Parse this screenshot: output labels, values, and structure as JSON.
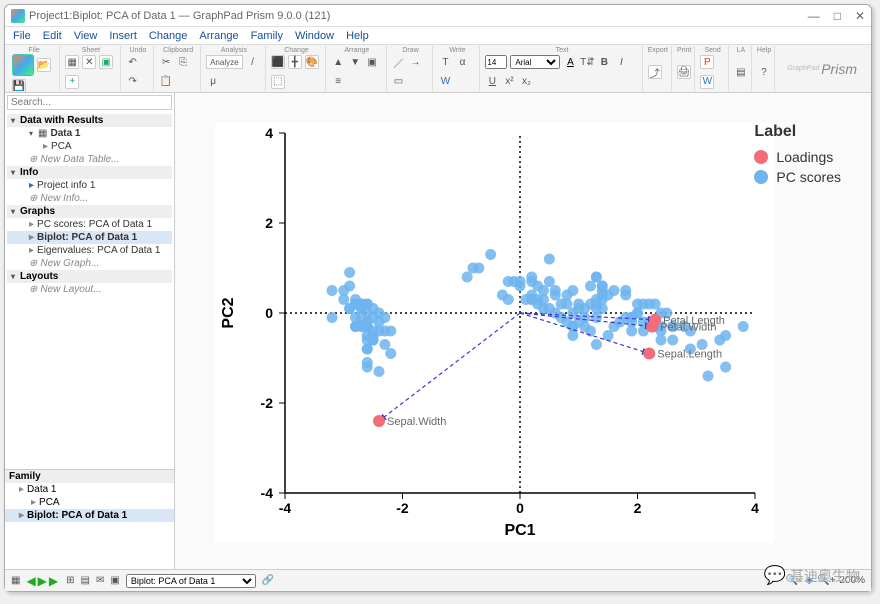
{
  "window": {
    "title": "Project1:Biplot: PCA of Data 1 — GraphPad Prism 9.0.0 (121)",
    "min": "—",
    "max": "□",
    "close": "✕"
  },
  "menu": [
    "File",
    "Edit",
    "View",
    "Insert",
    "Change",
    "Arrange",
    "Family",
    "Window",
    "Help"
  ],
  "ribbon": {
    "groups": [
      "File",
      "Sheet",
      "Undo",
      "Clipboard",
      "Analysis",
      "Change",
      "Arrange",
      "Draw",
      "Write",
      "Text",
      "Export",
      "Print",
      "Send",
      "LA",
      "Help"
    ],
    "font_size": "14",
    "font_name": "Arial",
    "analyze_btn": "Analyze",
    "logo": "Prism",
    "logo_sub": "GraphPad"
  },
  "search": {
    "placeholder": "Search..."
  },
  "tree": {
    "sections": [
      {
        "title": "Data with Results",
        "items": [
          {
            "label": "Data 1",
            "bold": true
          },
          {
            "label": "PCA",
            "sub": true
          },
          {
            "label": "New Data Table...",
            "new": true
          }
        ]
      },
      {
        "title": "Info",
        "items": [
          {
            "label": "Project info 1",
            "color": "#2a6db5"
          },
          {
            "label": "New Info...",
            "new": true
          }
        ]
      },
      {
        "title": "Graphs",
        "items": [
          {
            "label": "PC scores: PCA of Data 1"
          },
          {
            "label": "Biplot: PCA of Data 1",
            "sel": true
          },
          {
            "label": "Eigenvalues: PCA of Data 1"
          },
          {
            "label": "New Graph...",
            "new": true
          }
        ]
      },
      {
        "title": "Layouts",
        "items": [
          {
            "label": "New Layout...",
            "new": true
          }
        ]
      }
    ]
  },
  "family": {
    "title": "Family",
    "items": [
      {
        "label": "Data 1"
      },
      {
        "label": "PCA",
        "sub": true
      },
      {
        "label": "Biplot: PCA of Data 1",
        "sel": true
      }
    ]
  },
  "statusbar": {
    "sheet_selector": "Biplot: PCA of Data 1",
    "zoom": "200%"
  },
  "watermark": "基迪奥生物",
  "chart_data": {
    "type": "scatter",
    "xlabel": "PC1",
    "ylabel": "PC2",
    "xlim": [
      -4,
      4
    ],
    "ylim": [
      -4,
      4
    ],
    "xticks": [
      -4,
      -2,
      0,
      2,
      4
    ],
    "yticks": [
      -4,
      -2,
      0,
      2,
      4
    ],
    "legend": {
      "title": "Label",
      "items": [
        {
          "name": "Loadings",
          "color": "#f26d78"
        },
        {
          "name": "PC scores",
          "color": "#6eb4ef"
        }
      ]
    },
    "loadings": [
      {
        "label": "Sepal.Length",
        "x": 2.2,
        "y": -0.9
      },
      {
        "label": "Sepal.Width",
        "x": -2.4,
        "y": -2.4
      },
      {
        "label": "Petal.Length",
        "x": 2.3,
        "y": -0.15
      },
      {
        "label": "Petal.Width",
        "x": 2.25,
        "y": -0.3
      }
    ],
    "pc_scores": [
      [
        -2.7,
        -0.3
      ],
      [
        -2.7,
        0.2
      ],
      [
        -2.9,
        0.1
      ],
      [
        -2.8,
        0.3
      ],
      [
        -2.6,
        -0.3
      ],
      [
        -2.3,
        -0.7
      ],
      [
        -2.8,
        -0.1
      ],
      [
        -2.6,
        -0.2
      ],
      [
        -2.9,
        0.6
      ],
      [
        -2.7,
        0.1
      ],
      [
        -2.5,
        -0.6
      ],
      [
        -2.6,
        -0.0
      ],
      [
        -2.8,
        0.2
      ],
      [
        -3.2,
        0.5
      ],
      [
        -2.6,
        -1.2
      ],
      [
        -2.4,
        -1.3
      ],
      [
        -2.6,
        -0.8
      ],
      [
        -2.7,
        -0.3
      ],
      [
        -2.2,
        -0.9
      ],
      [
        -2.6,
        -0.5
      ],
      [
        -2.3,
        -0.4
      ],
      [
        -2.5,
        -0.4
      ],
      [
        -3.2,
        -0.1
      ],
      [
        -2.3,
        -0.1
      ],
      [
        -2.4,
        0.0
      ],
      [
        -2.5,
        0.1
      ],
      [
        -2.5,
        -0.1
      ],
      [
        -2.6,
        -0.3
      ],
      [
        -2.6,
        -0.3
      ],
      [
        -2.6,
        0.2
      ],
      [
        -2.6,
        0.2
      ],
      [
        -2.4,
        -0.4
      ],
      [
        -2.6,
        -0.8
      ],
      [
        -2.6,
        -1.1
      ],
      [
        -2.7,
        0.1
      ],
      [
        -2.9,
        0.1
      ],
      [
        -2.6,
        -0.6
      ],
      [
        -2.8,
        -0.3
      ],
      [
        -3.0,
        0.5
      ],
      [
        -2.6,
        -0.2
      ],
      [
        -2.8,
        -0.3
      ],
      [
        -2.9,
        0.9
      ],
      [
        -3.0,
        0.3
      ],
      [
        -2.4,
        -0.2
      ],
      [
        -2.2,
        -0.4
      ],
      [
        -2.7,
        0.2
      ],
      [
        -2.5,
        -0.5
      ],
      [
        -2.8,
        0.2
      ],
      [
        -2.5,
        -0.6
      ],
      [
        -2.7,
        -0.1
      ],
      [
        1.3,
        -0.7
      ],
      [
        0.9,
        -0.3
      ],
      [
        1.5,
        -0.5
      ],
      [
        0.2,
        0.8
      ],
      [
        1.1,
        -0.1
      ],
      [
        0.6,
        0.4
      ],
      [
        1.1,
        -0.3
      ],
      [
        -0.8,
        1.0
      ],
      [
        1.0,
        -0.2
      ],
      [
        0.0,
        0.7
      ],
      [
        -0.5,
        1.3
      ],
      [
        0.5,
        0.1
      ],
      [
        0.3,
        0.6
      ],
      [
        1.0,
        0.1
      ],
      [
        -0.2,
        0.3
      ],
      [
        0.9,
        -0.5
      ],
      [
        0.7,
        0.2
      ],
      [
        0.2,
        0.3
      ],
      [
        0.9,
        0.5
      ],
      [
        0.0,
        0.6
      ],
      [
        1.1,
        0.1
      ],
      [
        0.4,
        0.1
      ],
      [
        1.3,
        0.3
      ],
      [
        1.0,
        0.2
      ],
      [
        0.7,
        -0.1
      ],
      [
        0.9,
        -0.3
      ],
      [
        1.3,
        -0.1
      ],
      [
        1.6,
        -0.3
      ],
      [
        0.8,
        0.2
      ],
      [
        -0.3,
        0.4
      ],
      [
        -0.1,
        0.7
      ],
      [
        -0.2,
        0.7
      ],
      [
        0.1,
        0.3
      ],
      [
        1.4,
        0.4
      ],
      [
        0.6,
        0.5
      ],
      [
        0.8,
        -0.2
      ],
      [
        1.2,
        -0.4
      ],
      [
        0.8,
        0.4
      ],
      [
        0.2,
        0.3
      ],
      [
        0.2,
        0.7
      ],
      [
        0.5,
        0.7
      ],
      [
        0.9,
        0.0
      ],
      [
        0.2,
        0.4
      ],
      [
        -0.7,
        1.0
      ],
      [
        0.4,
        0.5
      ],
      [
        0.3,
        0.2
      ],
      [
        0.4,
        0.3
      ],
      [
        0.6,
        -0.0
      ],
      [
        -0.9,
        0.8
      ],
      [
        0.3,
        0.3
      ],
      [
        2.5,
        0.0
      ],
      [
        1.4,
        0.6
      ],
      [
        2.6,
        -0.3
      ],
      [
        2.0,
        0.2
      ],
      [
        2.4,
        0.0
      ],
      [
        3.4,
        -0.6
      ],
      [
        0.5,
        1.2
      ],
      [
        2.9,
        -0.4
      ],
      [
        2.3,
        0.2
      ],
      [
        2.9,
        -0.8
      ],
      [
        1.7,
        -0.2
      ],
      [
        1.8,
        0.4
      ],
      [
        2.2,
        -0.2
      ],
      [
        1.3,
        0.8
      ],
      [
        1.6,
        0.5
      ],
      [
        1.9,
        -0.1
      ],
      [
        2.0,
        0.0
      ],
      [
        3.5,
        -1.2
      ],
      [
        3.8,
        -0.3
      ],
      [
        1.3,
        0.8
      ],
      [
        2.4,
        -0.4
      ],
      [
        1.2,
        0.6
      ],
      [
        3.5,
        -0.5
      ],
      [
        1.4,
        0.5
      ],
      [
        2.3,
        -0.3
      ],
      [
        2.6,
        -0.6
      ],
      [
        1.3,
        0.2
      ],
      [
        1.3,
        0.1
      ],
      [
        2.1,
        0.2
      ],
      [
        2.4,
        -0.6
      ],
      [
        2.8,
        -0.3
      ],
      [
        3.2,
        -1.4
      ],
      [
        2.2,
        0.2
      ],
      [
        1.4,
        0.1
      ],
      [
        1.8,
        0.5
      ],
      [
        3.1,
        -0.7
      ],
      [
        2.1,
        -0.2
      ],
      [
        2.0,
        0.0
      ],
      [
        1.2,
        0.2
      ],
      [
        2.1,
        -0.4
      ],
      [
        2.3,
        -0.2
      ],
      [
        1.9,
        -0.4
      ],
      [
        1.4,
        0.6
      ],
      [
        2.6,
        -0.3
      ],
      [
        2.4,
        -0.3
      ],
      [
        1.9,
        -0.2
      ],
      [
        1.5,
        0.4
      ],
      [
        1.8,
        -0.1
      ],
      [
        1.9,
        -0.1
      ],
      [
        1.4,
        0.3
      ]
    ]
  }
}
